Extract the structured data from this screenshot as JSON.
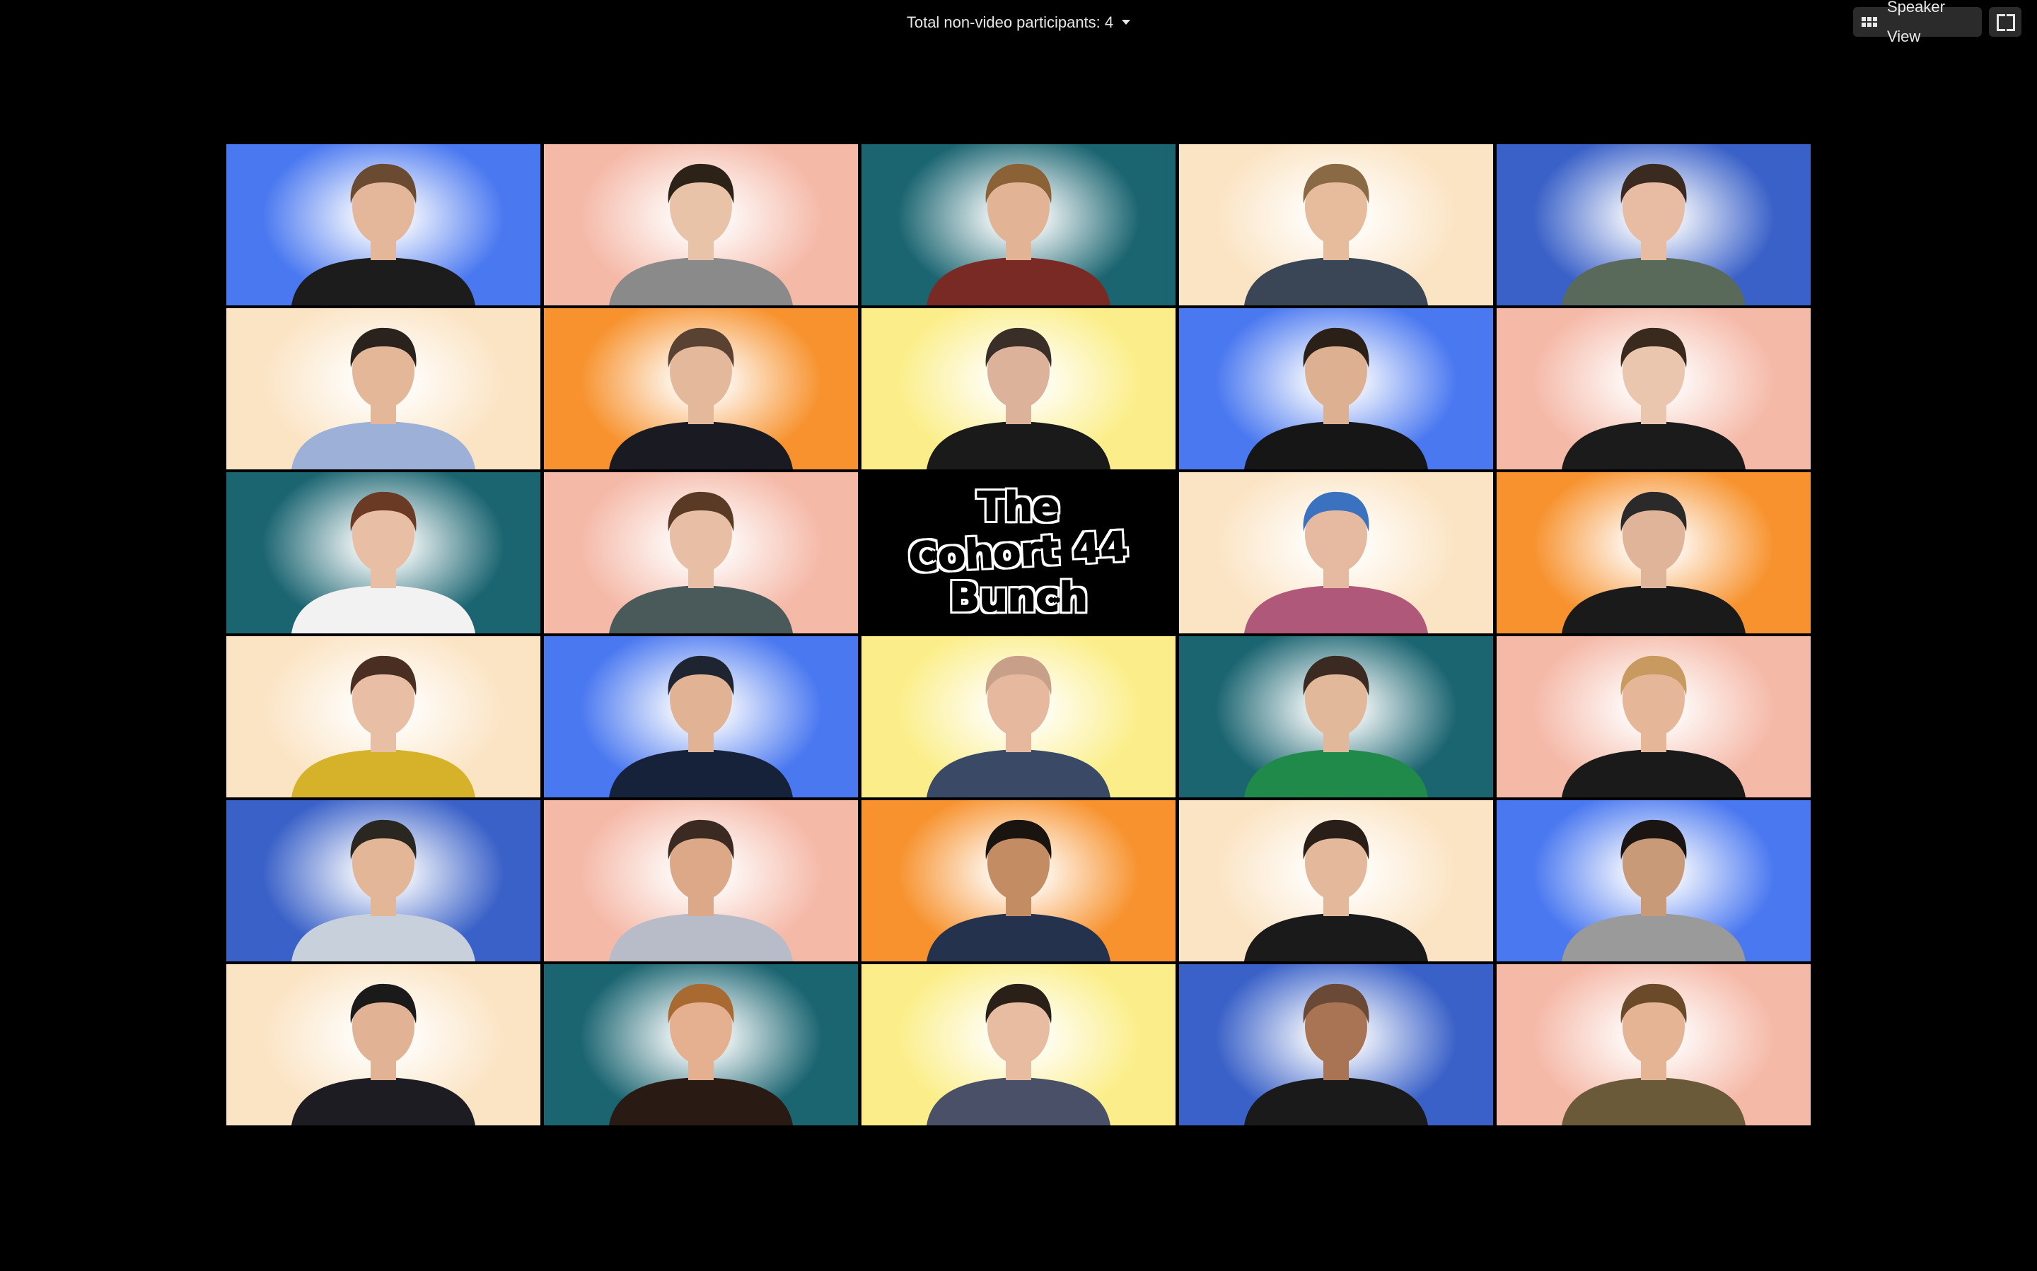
{
  "top_bar": {
    "non_video_label": "Total non-video participants: 4",
    "speaker_view_label": "Speaker View",
    "speaker_view_icon": "grid-icon",
    "fullscreen_icon": "fullscreen-icon"
  },
  "title_tile": {
    "lines": [
      "The",
      "Cohort 44",
      "Bunch"
    ]
  },
  "tiles": [
    {
      "type": "person",
      "background": "#4a78f0",
      "shirt": "#1c1c1c",
      "skin": "#e4b79a",
      "hair": "#6a4a30"
    },
    {
      "type": "person",
      "background": "#f5b9a8",
      "shirt": "#8a8a8a",
      "skin": "#e9c3a8",
      "hair": "#2c2218"
    },
    {
      "type": "person",
      "background": "#1b6571",
      "shirt": "#7a2a24",
      "skin": "#e2b394",
      "hair": "#8a6236"
    },
    {
      "type": "person",
      "background": "#fbe4c4",
      "shirt": "#3a4556",
      "skin": "#e6bc9c",
      "hair": "#8a6a44"
    },
    {
      "type": "person",
      "background": "#3a61c8",
      "shirt": "#5a6a5a",
      "skin": "#e7bca3",
      "hair": "#3b2a20"
    },
    {
      "type": "person",
      "background": "#fbe4c4",
      "shirt": "#9db0d8",
      "skin": "#e3b797",
      "hair": "#2a221c"
    },
    {
      "type": "person",
      "background": "#f7922e",
      "shirt": "#1a1a22",
      "skin": "#e4b89a",
      "hair": "#5a4232"
    },
    {
      "type": "person",
      "background": "#fbee8a",
      "shirt": "#1a1a1a",
      "skin": "#dcb29a",
      "hair": "#3a2e28"
    },
    {
      "type": "person",
      "background": "#4a78f0",
      "shirt": "#161616",
      "skin": "#deb092",
      "hair": "#2a2018"
    },
    {
      "type": "person",
      "background": "#f5b9a8",
      "shirt": "#1b1b1b",
      "skin": "#ebc6ae",
      "hair": "#3a2a1e"
    },
    {
      "type": "person",
      "background": "#1b6571",
      "shirt": "#f2f2f2",
      "skin": "#e8bea4",
      "hair": "#6a3a24"
    },
    {
      "type": "person",
      "background": "#f5b9a8",
      "shirt": "#4a5a5a",
      "skin": "#e8bfa4",
      "hair": "#5a3a24"
    },
    {
      "type": "title"
    },
    {
      "type": "person",
      "background": "#fbe4c4",
      "shirt": "#b0587a",
      "skin": "#e5baa0",
      "hair": "#3a72c0"
    },
    {
      "type": "person",
      "background": "#f7922e",
      "shirt": "#1a1a1a",
      "skin": "#e0b498",
      "hair": "#2a2a2a"
    },
    {
      "type": "person",
      "background": "#fbe4c4",
      "shirt": "#d6b22a",
      "skin": "#e8bea4",
      "hair": "#4a2e22"
    },
    {
      "type": "person",
      "background": "#4a78f0",
      "shirt": "#16213a",
      "skin": "#e1b394",
      "hair": "#1e2430"
    },
    {
      "type": "person",
      "background": "#fbee8a",
      "shirt": "#3a4a66",
      "skin": "#e6b89e",
      "hair": "#c8a08a"
    },
    {
      "type": "person",
      "background": "#1b6571",
      "shirt": "#1f8a4a",
      "skin": "#e2b89a",
      "hair": "#3a2a22"
    },
    {
      "type": "person",
      "background": "#f5b9a8",
      "shirt": "#1a1a1a",
      "skin": "#e6b698",
      "hair": "#c89a60"
    },
    {
      "type": "person",
      "background": "#3a61c8",
      "shirt": "#c8d0dc",
      "skin": "#e3b697",
      "hair": "#2a2620"
    },
    {
      "type": "person",
      "background": "#f5b9a8",
      "shirt": "#b8bcc8",
      "skin": "#dca888",
      "hair": "#3a2a22"
    },
    {
      "type": "person",
      "background": "#f7922e",
      "shirt": "#24324e",
      "skin": "#c48c62",
      "hair": "#1a1410"
    },
    {
      "type": "person",
      "background": "#fbe4c4",
      "shirt": "#1a1a1a",
      "skin": "#e4b89a",
      "hair": "#2a1e18"
    },
    {
      "type": "person",
      "background": "#4a78f0",
      "shirt": "#9a9a9a",
      "skin": "#c99a78",
      "hair": "#1a1412"
    },
    {
      "type": "person",
      "background": "#fbe4c4",
      "shirt": "#1c1c22",
      "skin": "#e2b294",
      "hair": "#1a1a1a"
    },
    {
      "type": "person",
      "background": "#1b6571",
      "shirt": "#2a1a14",
      "skin": "#e4b090",
      "hair": "#a86a30"
    },
    {
      "type": "person",
      "background": "#fbee8a",
      "shirt": "#4a5068",
      "skin": "#e8bca0",
      "hair": "#2a2018"
    },
    {
      "type": "person",
      "background": "#3a61c8",
      "shirt": "#1a1a1a",
      "skin": "#a87454",
      "hair": "#6a4a36"
    },
    {
      "type": "person",
      "background": "#f5b9a8",
      "shirt": "#6a5a3a",
      "skin": "#e4b494",
      "hair": "#6a4a28"
    }
  ]
}
